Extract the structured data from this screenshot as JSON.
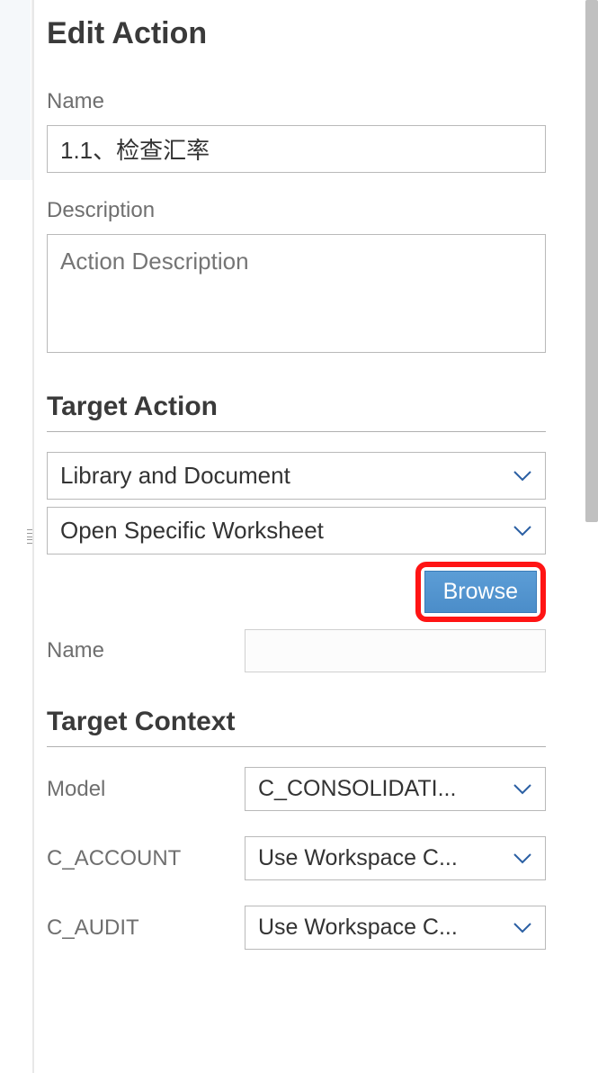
{
  "header": {
    "title": "Edit Action"
  },
  "fields": {
    "name_label": "Name",
    "name_value": "1.1、检查汇率",
    "description_label": "Description",
    "description_placeholder": "Action Description"
  },
  "target_action": {
    "section_title": "Target Action",
    "dropdown1": "Library and Document",
    "dropdown2": "Open Specific Worksheet",
    "browse_label": "Browse",
    "name_label": "Name",
    "name_value": ""
  },
  "target_context": {
    "section_title": "Target Context",
    "rows": [
      {
        "label": "Model",
        "value": "C_CONSOLIDATI..."
      },
      {
        "label": "C_ACCOUNT",
        "value": "Use Workspace C..."
      },
      {
        "label": "C_AUDIT",
        "value": "Use Workspace C..."
      }
    ]
  }
}
